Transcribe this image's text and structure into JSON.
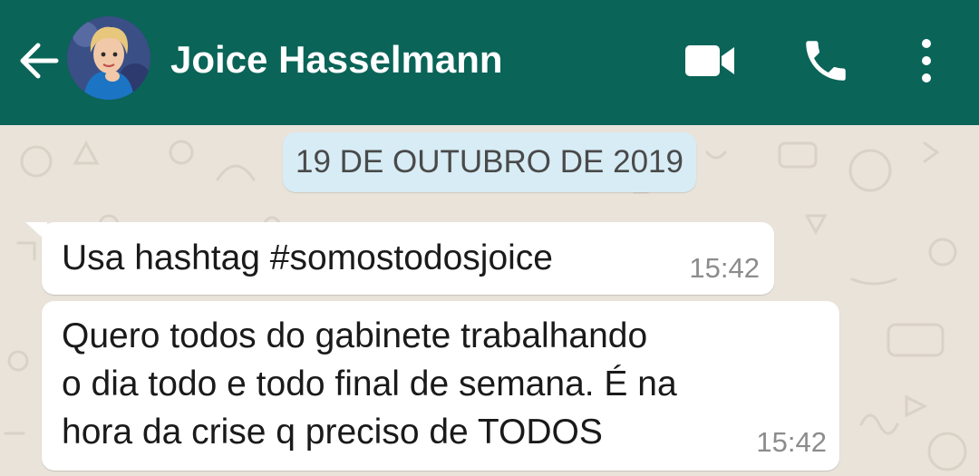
{
  "header": {
    "contact_name": "Joice Hasselmann",
    "back_icon": "arrow-left-icon",
    "video_icon": "video-camera-icon",
    "call_icon": "phone-icon",
    "menu_icon": "more-vertical-icon",
    "background_color": "#0a6458"
  },
  "chat": {
    "date_label": "19 DE OUTUBRO DE 2019",
    "wallpaper_color": "#e9e3da",
    "messages": [
      {
        "text": "Usa hashtag #somostodosjoice",
        "time": "15:42"
      },
      {
        "text": "Quero todos do gabinete trabalhando\no dia todo e todo final de semana. É na\nhora da crise q preciso de TODOS",
        "time": "15:42"
      }
    ]
  }
}
